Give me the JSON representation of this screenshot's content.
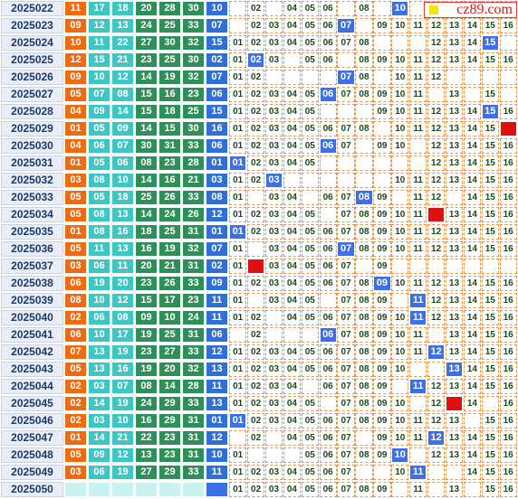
{
  "site_label": "cz89.com",
  "distribution_numbers": [
    "01",
    "02",
    "03",
    "04",
    "05",
    "06",
    "07",
    "08",
    "09",
    "10",
    "11",
    "12",
    "13",
    "14",
    "15",
    "16"
  ],
  "colors": {
    "front1": "#f06a10",
    "front2_3": "#3ec7c2",
    "front4_6": "#2f8f58",
    "blue": "#2e6fd8",
    "hit": "#3d6fe6",
    "red": "#e01010"
  },
  "rows": [
    {
      "issue": "2025022",
      "balls": [
        "11",
        "17",
        "18",
        "20",
        "28",
        "30",
        "10"
      ],
      "hits": [
        10
      ],
      "red": []
    },
    {
      "issue": "2025023",
      "balls": [
        "09",
        "12",
        "13",
        "24",
        "25",
        "33",
        "07"
      ],
      "hits": [
        7
      ],
      "red": []
    },
    {
      "issue": "2025024",
      "balls": [
        "10",
        "11",
        "22",
        "27",
        "30",
        "32",
        "15"
      ],
      "hits": [
        15
      ],
      "red": []
    },
    {
      "issue": "2025025",
      "balls": [
        "12",
        "15",
        "21",
        "23",
        "25",
        "30",
        "02"
      ],
      "hits": [
        2
      ],
      "red": []
    },
    {
      "issue": "2025026",
      "balls": [
        "09",
        "10",
        "12",
        "14",
        "19",
        "32",
        "07"
      ],
      "hits": [
        7
      ],
      "red": []
    },
    {
      "issue": "2025027",
      "balls": [
        "05",
        "07",
        "08",
        "15",
        "16",
        "23",
        "06"
      ],
      "hits": [
        6
      ],
      "red": []
    },
    {
      "issue": "2025028",
      "balls": [
        "04",
        "09",
        "14",
        "15",
        "18",
        "25",
        "15"
      ],
      "hits": [
        15
      ],
      "red": []
    },
    {
      "issue": "2025029",
      "balls": [
        "01",
        "05",
        "09",
        "14",
        "15",
        "30",
        "16"
      ],
      "hits": [],
      "red": [
        16
      ]
    },
    {
      "issue": "2025030",
      "balls": [
        "04",
        "06",
        "07",
        "30",
        "31",
        "33",
        "06"
      ],
      "hits": [
        6
      ],
      "red": []
    },
    {
      "issue": "2025031",
      "balls": [
        "01",
        "05",
        "06",
        "08",
        "23",
        "28",
        "01"
      ],
      "hits": [
        1
      ],
      "red": []
    },
    {
      "issue": "2025032",
      "balls": [
        "03",
        "08",
        "10",
        "14",
        "16",
        "21",
        "03"
      ],
      "hits": [
        3
      ],
      "red": []
    },
    {
      "issue": "2025033",
      "balls": [
        "05",
        "05",
        "18",
        "25",
        "26",
        "33",
        "08"
      ],
      "hits": [
        8
      ],
      "red": []
    },
    {
      "issue": "2025034",
      "balls": [
        "05",
        "08",
        "13",
        "14",
        "24",
        "26",
        "12"
      ],
      "hits": [],
      "red": [
        12
      ]
    },
    {
      "issue": "2025035",
      "balls": [
        "01",
        "08",
        "16",
        "18",
        "25",
        "31",
        "01"
      ],
      "hits": [
        1
      ],
      "red": []
    },
    {
      "issue": "2025036",
      "balls": [
        "05",
        "11",
        "13",
        "16",
        "19",
        "32",
        "07"
      ],
      "hits": [
        7
      ],
      "red": []
    },
    {
      "issue": "2025037",
      "balls": [
        "03",
        "06",
        "11",
        "20",
        "21",
        "31",
        "02"
      ],
      "hits": [],
      "red": [
        2
      ]
    },
    {
      "issue": "2025038",
      "balls": [
        "06",
        "19",
        "20",
        "23",
        "26",
        "33",
        "09"
      ],
      "hits": [
        9
      ],
      "red": []
    },
    {
      "issue": "2025039",
      "balls": [
        "08",
        "10",
        "12",
        "15",
        "17",
        "23",
        "11"
      ],
      "hits": [
        11
      ],
      "red": []
    },
    {
      "issue": "2025040",
      "balls": [
        "02",
        "06",
        "08",
        "09",
        "10",
        "24",
        "11"
      ],
      "hits": [
        11
      ],
      "red": []
    },
    {
      "issue": "2025041",
      "balls": [
        "06",
        "10",
        "17",
        "19",
        "25",
        "31",
        "06"
      ],
      "hits": [
        6
      ],
      "red": []
    },
    {
      "issue": "2025042",
      "balls": [
        "07",
        "13",
        "19",
        "23",
        "27",
        "33",
        "12"
      ],
      "hits": [
        12
      ],
      "red": []
    },
    {
      "issue": "2025043",
      "balls": [
        "05",
        "13",
        "16",
        "19",
        "20",
        "32",
        "13"
      ],
      "hits": [
        13
      ],
      "red": []
    },
    {
      "issue": "2025044",
      "balls": [
        "02",
        "03",
        "07",
        "08",
        "14",
        "28",
        "11"
      ],
      "hits": [
        11
      ],
      "red": []
    },
    {
      "issue": "2025045",
      "balls": [
        "02",
        "14",
        "19",
        "24",
        "29",
        "33",
        "13"
      ],
      "hits": [],
      "red": [
        13
      ]
    },
    {
      "issue": "2025046",
      "balls": [
        "02",
        "03",
        "10",
        "16",
        "29",
        "31",
        "01"
      ],
      "hits": [
        1
      ],
      "red": []
    },
    {
      "issue": "2025047",
      "balls": [
        "01",
        "14",
        "21",
        "22",
        "23",
        "31",
        "12"
      ],
      "hits": [
        12
      ],
      "red": []
    },
    {
      "issue": "2025048",
      "balls": [
        "05",
        "09",
        "12",
        "13",
        "23",
        "31",
        "10"
      ],
      "hits": [
        10
      ],
      "red": []
    },
    {
      "issue": "2025049",
      "balls": [
        "03",
        "06",
        "19",
        "27",
        "29",
        "33",
        "11"
      ],
      "hits": [
        11
      ],
      "red": []
    },
    {
      "issue": "2025050",
      "balls": [
        "",
        "",
        "",
        "",
        "",
        "",
        ""
      ],
      "hits": [],
      "red": []
    }
  ],
  "missing": {
    "2025022": [
      1,
      3,
      7,
      9,
      11,
      12,
      13,
      14,
      15,
      16
    ],
    "2025023": [
      1,
      8
    ],
    "2025024": [
      9,
      10,
      11,
      16
    ],
    "2025025": [
      4,
      7
    ],
    "2025026": [
      3,
      4,
      5,
      6,
      9,
      13,
      14,
      15,
      16
    ],
    "2025027": [
      12,
      14,
      16
    ],
    "2025028": [
      6,
      7,
      8
    ],
    "2025029": [
      9
    ],
    "2025030": [
      8,
      11
    ],
    "2025031": [
      6,
      7,
      8,
      9,
      10,
      11
    ],
    "2025032": [
      4,
      5,
      6,
      7,
      8,
      9
    ],
    "2025033": [
      2,
      5,
      10,
      13
    ],
    "2025034": [
      6
    ],
    "2025035": [],
    "2025036": [
      2
    ],
    "2025037": [
      8,
      10,
      11,
      12,
      13,
      14,
      15,
      16
    ],
    "2025038": [],
    "2025039": [
      2,
      6,
      10
    ],
    "2025040": [
      3
    ],
    "2025041": [
      1,
      3,
      4,
      5,
      12
    ],
    "2025042": [],
    "2025043": [
      11,
      12
    ],
    "2025044": [
      5,
      10
    ],
    "2025045": [
      6,
      11,
      15
    ],
    "2025046": [
      14
    ],
    "2025047": [
      1,
      3,
      8
    ],
    "2025048": [
      2,
      3,
      4,
      11
    ],
    "2025049": [
      8,
      9,
      12,
      13
    ],
    "2025050": [
      10,
      12,
      14
    ]
  }
}
